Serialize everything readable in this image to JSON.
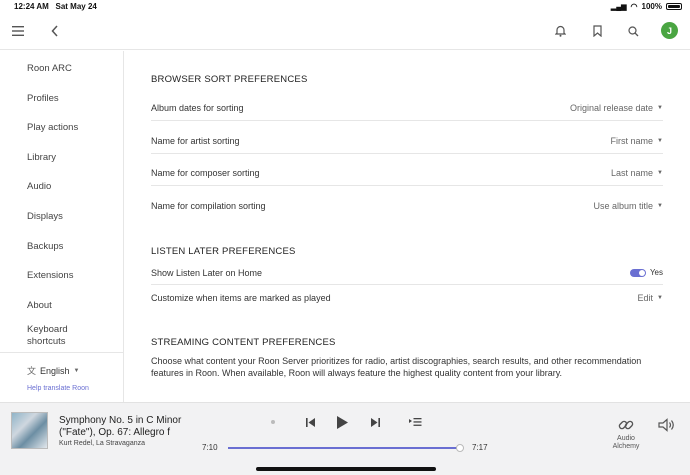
{
  "status": {
    "time": "12:24 AM",
    "date": "Sat May 24",
    "battery": "100%"
  },
  "topbar": {
    "avatar_letter": "J"
  },
  "sidebar": {
    "items": [
      {
        "label": "Roon ARC"
      },
      {
        "label": "Profiles"
      },
      {
        "label": "Play actions"
      },
      {
        "label": "Library"
      },
      {
        "label": "Audio"
      },
      {
        "label": "Displays"
      },
      {
        "label": "Backups"
      },
      {
        "label": "Extensions"
      },
      {
        "label": "About"
      },
      {
        "label": "Keyboard shortcuts"
      }
    ],
    "language": "English",
    "help_link": "Help translate Roon"
  },
  "browser_sort": {
    "title": "BROWSER SORT PREFERENCES",
    "rows": [
      {
        "label": "Album dates for sorting",
        "value": "Original release date"
      },
      {
        "label": "Name for artist sorting",
        "value": "First name"
      },
      {
        "label": "Name for composer sorting",
        "value": "Last name"
      },
      {
        "label": "Name for compilation sorting",
        "value": "Use album title"
      }
    ]
  },
  "listen_later": {
    "title": "LISTEN LATER PREFERENCES",
    "show_label": "Show Listen Later on Home",
    "show_value": "Yes",
    "show_enabled": true,
    "customize_label": "Customize when items are marked as played",
    "customize_value": "Edit"
  },
  "streaming": {
    "title": "STREAMING CONTENT PREFERENCES",
    "description": "Choose what content your Roon Server prioritizes for radio, artist discographies, search results, and other recommendation features in Roon. When available, Roon will always feature the highest quality content from your library."
  },
  "player": {
    "track_title": "Symphony No. 5 in C Minor (\"Fate\"), Op. 67: Allegro f",
    "track_artist": "Kurt Redel, La Stravaganza",
    "time_elapsed": "7:10",
    "time_total": "7:17",
    "progress_fraction": 0.984,
    "alchemy_label": "Audio Alchemy"
  },
  "colors": {
    "accent": "#6a6fd2",
    "avatar": "#4aa542"
  }
}
